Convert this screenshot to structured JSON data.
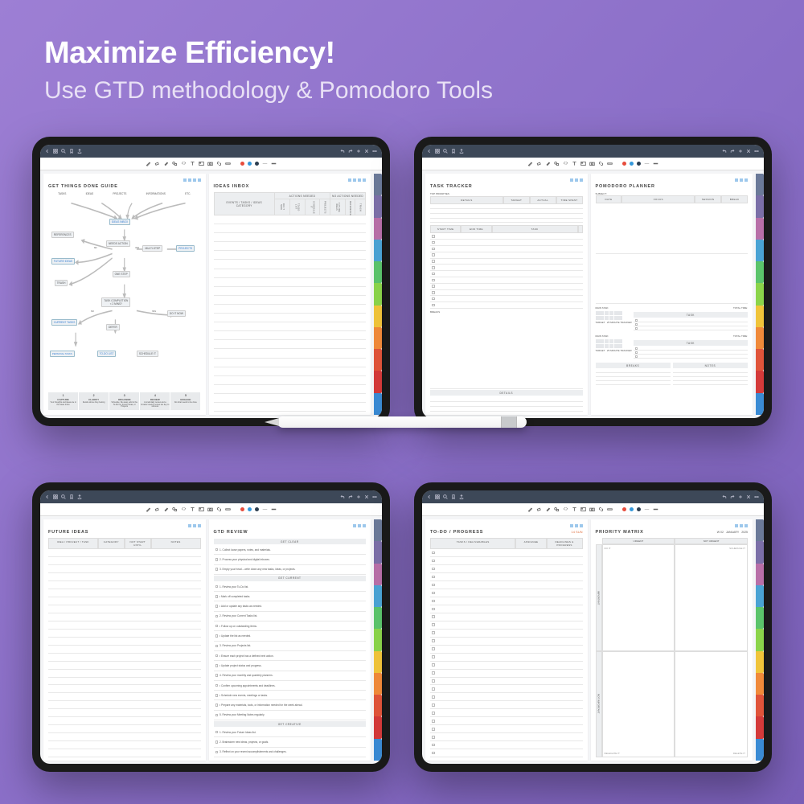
{
  "headline": {
    "title": "Maximize Efficiency!",
    "subtitle": "Use GTD methodology & Pomodoro Tools"
  },
  "tab_colors": [
    "#6b7a99",
    "#7b6fa8",
    "#b86fa8",
    "#4aa3d4",
    "#5bc46b",
    "#8bd44a",
    "#f0c43a",
    "#f08a3a",
    "#e0543a",
    "#d43a3a",
    "#3a8bd4"
  ],
  "tool_colors": {
    "red": "#e74c3c",
    "blue": "#3498db",
    "black": "#2c3e50"
  },
  "gtd_guide": {
    "title": "GET THINGS DONE GUIDE",
    "top_row": [
      "TASKS",
      "IDEAS",
      "PROJECTS",
      "INFORMATIONS",
      "ETC."
    ],
    "nodes": {
      "inbox": "IDEAS INBOX",
      "action": "NEEDS ACTION",
      "references": "REFERENCES",
      "future": "FUTURE IDEAS",
      "trash": "TRASH",
      "multistep": "MULTI-STEP",
      "projects": "PROJECTS",
      "onestep": "ONE STEP",
      "completion": "TASK COMPLETION\n< 2 MINS?",
      "defer": "DEFER",
      "doit": "DO IT NOW",
      "current": "CURRENT TASKS",
      "personal": "PERSONAL TASKS",
      "todo": "TO-DO LIST",
      "schedule": "SCHEDULE IT"
    },
    "yn": {
      "yes": "YES",
      "no": "NO"
    },
    "steps": [
      {
        "n": "1",
        "t": "CAPTURE",
        "d": "Your thoughts and ideas are in the Ideas Inbox"
      },
      {
        "n": "2",
        "t": "CLARIFY",
        "d": "Decide where they belong"
      },
      {
        "n": "3",
        "t": "ORGANIZE",
        "d": "Schedule, file away, add to the To-Do list, Future Ideas, or Projects"
      },
      {
        "n": "4",
        "t": "REVIEW",
        "d": "A small daily review and a broader weekly review are key to success"
      },
      {
        "n": "5",
        "t": "ENGAGE",
        "d": "Do what needs to be done"
      }
    ]
  },
  "ideas_inbox": {
    "title": "IDEAS INBOX",
    "col1": "EVENTS / TASKS / IDEAS\nCATEGORY",
    "group1": "ACTIONS NEEDED",
    "group2": "NO ACTIONS NEEDED",
    "subcols": [
      "DO IT NOW",
      "TO-DO LIST",
      "SCHEDULE IT",
      "PROJECTS",
      "FUTURE IDEAS",
      "REFERENCE",
      "TRASH"
    ]
  },
  "task_tracker": {
    "title": "TASK TRACKER",
    "top_label": "TOP PRIORITIES",
    "cols_top": [
      "DETAILS",
      "TARGET",
      "ACTUAL",
      "TIME SPENT"
    ],
    "cols_bot": [
      "START TIME",
      "END TIME",
      "TASK"
    ],
    "breaks": "BREAKS",
    "details": "DETAILS"
  },
  "pomodoro": {
    "title": "POMODORO PLANNER",
    "subject": "SUBJECT:",
    "cols": [
      "DATE",
      "FOCUS",
      "SESSION",
      "BREAK"
    ],
    "main_task": "MAIN TASK:",
    "total_time": "TOTAL TIME:",
    "task": "TASK",
    "target": "TARGET",
    "tracker": "25 MINUTE TRACKER",
    "breaks": "BREAKS",
    "notes": "NOTES"
  },
  "future_ideas": {
    "title": "FUTURE IDEAS",
    "cols": [
      "IDEA / PROJECT / TASK",
      "CATEGORY",
      "NOT START UNTIL",
      "NOTES"
    ]
  },
  "gtd_review": {
    "title": "GTD REVIEW",
    "sections": {
      "clear": "GET CLEAR",
      "current": "GET CURRENT",
      "creative": "GET CREATIVE"
    },
    "items": [
      "1. Collect loose papers, notes, and materials.",
      "2. Process your physical and digital inboxes.",
      "3. Empty your head – write down any new tasks, ideas, or projects.",
      "1. Review your To-Do list.",
      "• Mark off completed tasks.",
      "• Add or update any tasks as needed.",
      "2. Review your Current Tasks list.",
      "• Follow up on outstanding items.",
      "• Update the list as needed.",
      "3. Review your Projects list.",
      "• Ensure each project has a defined next action.",
      "• Update project status and progress.",
      "4. Review your monthly and quarterly planners.",
      "• Confirm upcoming appointments and deadlines.",
      "• Schedule new events, meetings or tasks.",
      "• Prepare any materials, tools, or information needed for the week ahead.",
      "5. Review your Meeting Notes regularly.",
      "1. Review your Future Ideas list.",
      "2. Brainstorm new ideas, projects, or goals.",
      "3. Reflect on your recent accomplishments and challenges."
    ]
  },
  "todo": {
    "title": "TO-DO / PROGRESS",
    "date": "14 SUN",
    "cols": [
      "TASKS / DELIVERABLES",
      "ASSIGNEE",
      "DEADLINES & PROGRESS"
    ]
  },
  "matrix": {
    "title": "PRIORITY MATRIX",
    "date": {
      "wk": "W 02",
      "month": "JANUARY",
      "year": "2025"
    },
    "x": [
      "URGENT",
      "NOT URGENT"
    ],
    "y": [
      "IMPORTANT",
      "NOT IMPORTANT"
    ],
    "quads": [
      "DO IT",
      "SCHEDULE IT",
      "DELEGATE IT",
      "DELETE IT"
    ]
  }
}
